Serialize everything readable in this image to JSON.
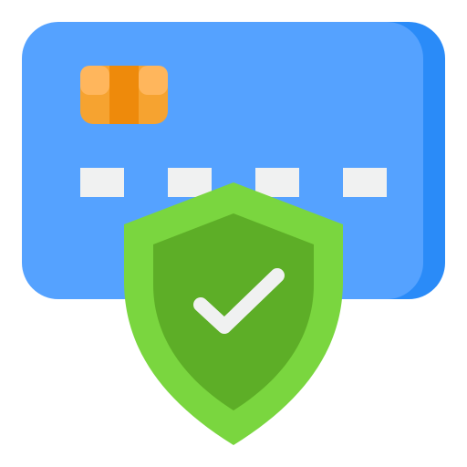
{
  "illustration": {
    "subject": "secure-payment-card",
    "icons": [
      "credit-card-icon",
      "card-chip-icon",
      "shield-icon",
      "checkmark-icon"
    ],
    "colors": {
      "card_back": "#2A8BF8",
      "card_face": "#55A2FF",
      "chip_outer": "#F6A330",
      "chip_inner": "#EE8A0B",
      "chip_highlight": "#FFB65C",
      "number_blocks": "#F0F1F1",
      "shield_outer": "#7AD63F",
      "shield_inner": "#5DAE27",
      "check": "#F0F1F1"
    },
    "card_number_groups": 4
  }
}
